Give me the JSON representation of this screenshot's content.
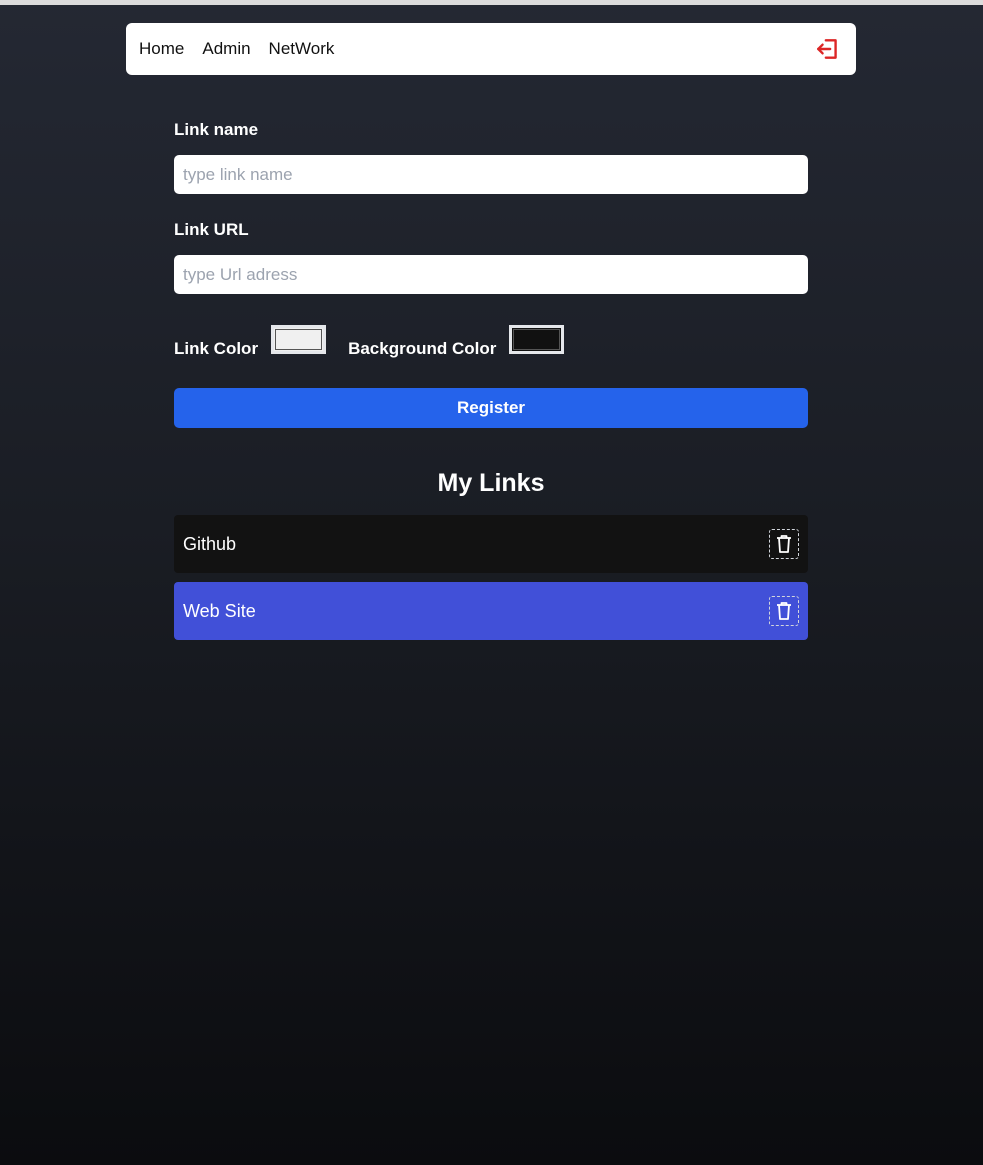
{
  "nav": {
    "items": [
      {
        "label": "Home"
      },
      {
        "label": "Admin"
      },
      {
        "label": "NetWork"
      }
    ],
    "logout_icon": "logout-icon",
    "logout_color": "#dc2626"
  },
  "form": {
    "name_label": "Link name",
    "name_placeholder": "type link name",
    "name_value": "",
    "url_label": "Link URL",
    "url_placeholder": "type Url adress",
    "url_value": "",
    "link_color_label": "Link Color",
    "link_color_value": "#f0f0f0",
    "background_color_label": "Background Color",
    "background_color_value": "#111111",
    "register_label": "Register",
    "register_color": "#2563eb"
  },
  "links": {
    "title": "My Links",
    "items": [
      {
        "label": "Github",
        "text_color": "#ffffff",
        "background": "#121212"
      },
      {
        "label": "Web Site",
        "text_color": "#ffffff",
        "background": "#4150d8"
      }
    ],
    "delete_icon": "trash-icon"
  }
}
